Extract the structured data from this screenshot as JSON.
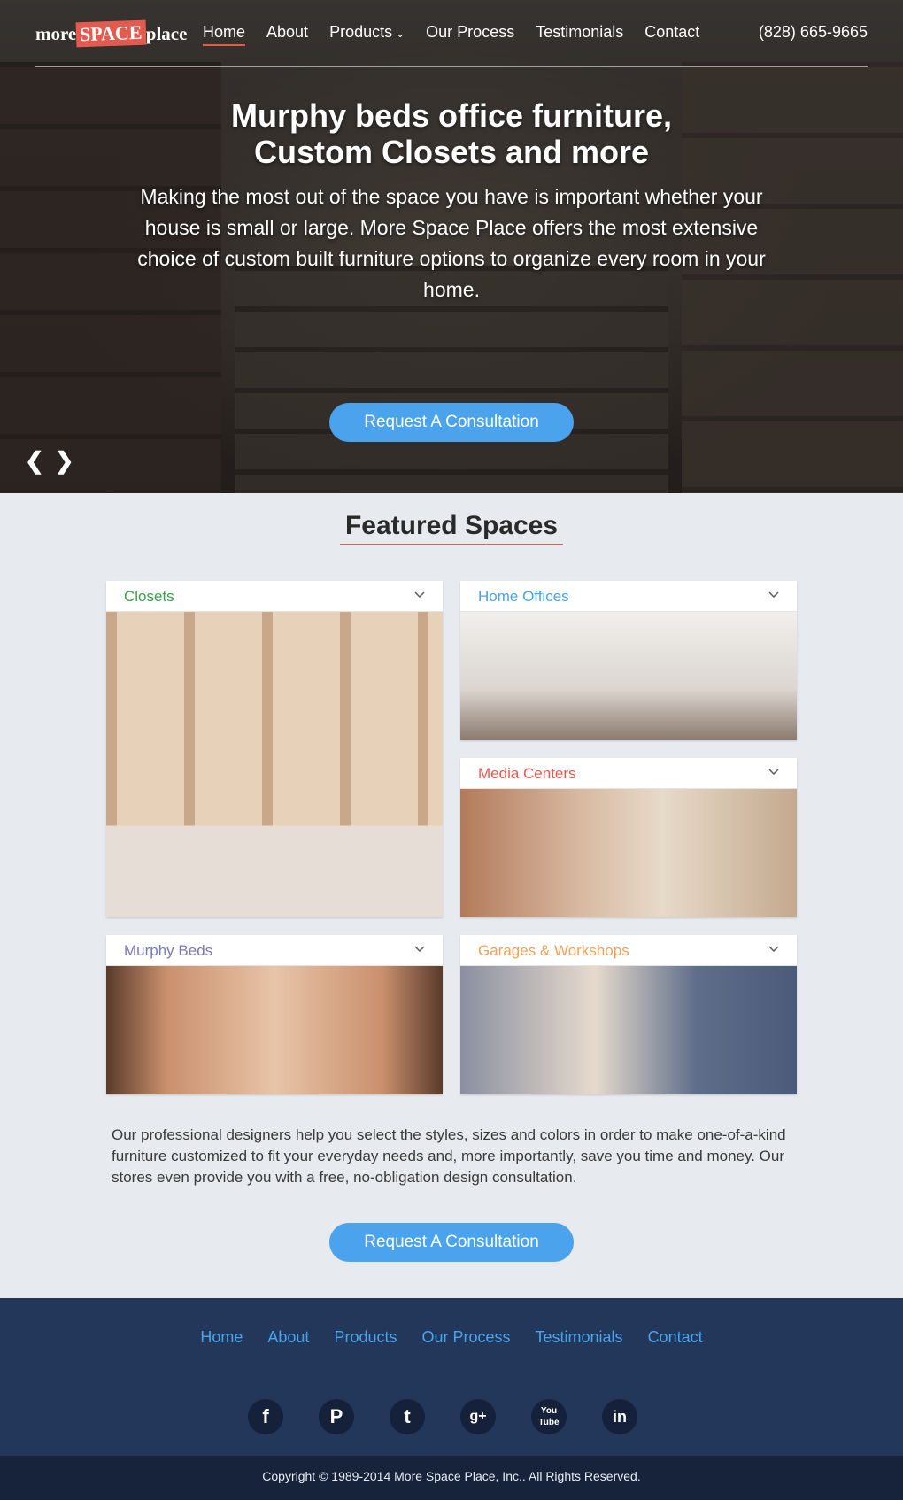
{
  "header": {
    "logo": {
      "left": "more",
      "mid": "SPACE",
      "right": "place"
    },
    "nav": [
      {
        "label": "Home"
      },
      {
        "label": "About"
      },
      {
        "label": "Products"
      },
      {
        "label": "Our Process"
      },
      {
        "label": "Testimonials"
      },
      {
        "label": "Contact"
      }
    ],
    "phone": "(828) 665-9665"
  },
  "hero": {
    "title_line1": "Murphy beds office furniture,",
    "title_line2": "Custom Closets and more",
    "text": "Making the most out of the space you have is important whether your house is small or large. More Space Place offers the most extensive choice of custom built furniture options to organize every room in your home.",
    "cta": "Request A Consultation"
  },
  "featured": {
    "title": "Featured Spaces",
    "cards": {
      "closets": {
        "label": "Closets",
        "color": "#3aa04a"
      },
      "home_offices": {
        "label": "Home Offices",
        "color": "#4aa3ec"
      },
      "media_centers": {
        "label": "Media Centers",
        "color": "#e35b4f"
      },
      "murphy_beds": {
        "label": "Murphy Beds",
        "color": "#7b78b8"
      },
      "garages": {
        "label": "Garages & Workshops",
        "color": "#f0a25c"
      }
    },
    "description": "Our professional designers help you select the styles, sizes and colors in order to make one-of-a-kind furniture customized to fit your everyday needs and, more importantly, save you time and money. Our stores even provide you with a free, no-obligation design consultation.",
    "cta": "Request A Consultation"
  },
  "footer": {
    "nav": [
      "Home",
      "About",
      "Products",
      "Our Process",
      "Testimonials",
      "Contact"
    ],
    "social": [
      {
        "icon": "facebook-icon",
        "glyph": "f"
      },
      {
        "icon": "pinterest-icon",
        "glyph": "P"
      },
      {
        "icon": "twitter-icon",
        "glyph": "t"
      },
      {
        "icon": "google-plus-icon",
        "glyph": "g+"
      },
      {
        "icon": "youtube-icon",
        "glyph": "You Tube"
      },
      {
        "icon": "linkedin-icon",
        "glyph": "in"
      }
    ],
    "copyright": "Copyright © 1989-2014 More Space Place, Inc.. All Rights Reserved."
  }
}
